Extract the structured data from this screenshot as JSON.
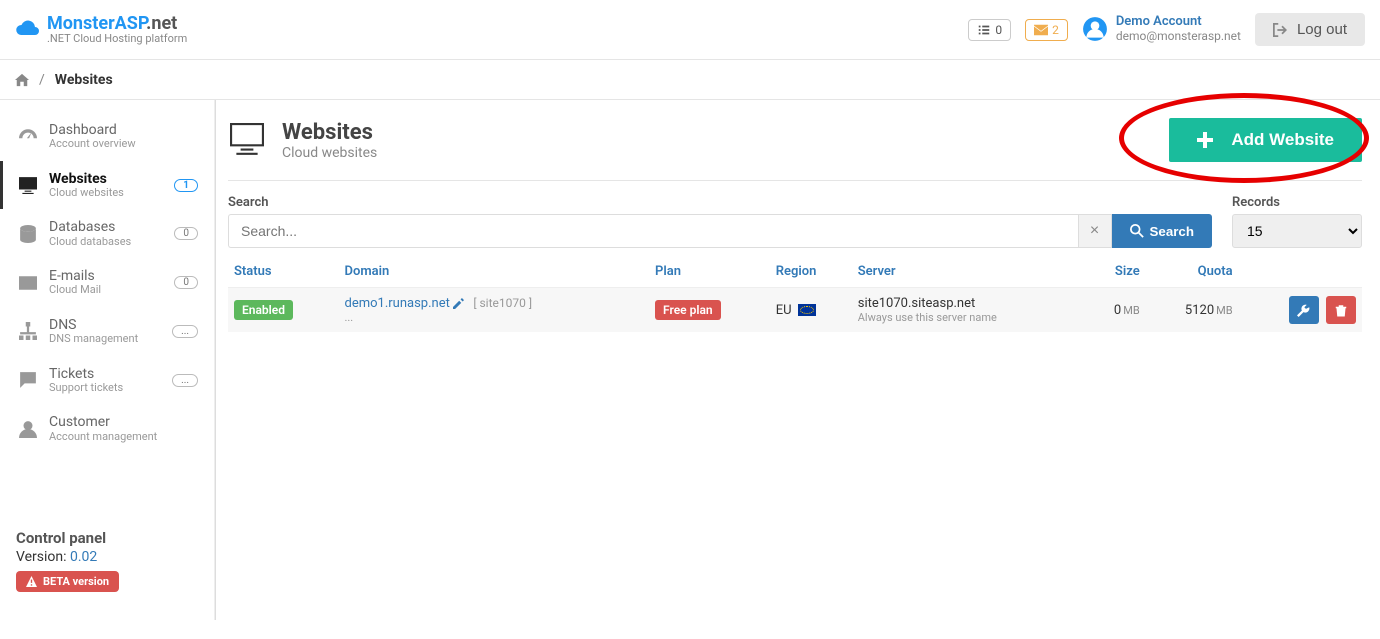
{
  "brand": {
    "name_html_a": "Monster",
    "name_html_b": "ASP",
    "name_html_c": ".net",
    "tagline": ".NET Cloud Hosting platform"
  },
  "top": {
    "tasks_count": "0",
    "mail_count": "2",
    "account_name": "Demo Account",
    "account_email": "demo@monsterasp.net",
    "logout": "Log out"
  },
  "breadcrumb": {
    "current": "Websites"
  },
  "sidebar": {
    "items": [
      {
        "title": "Dashboard",
        "sub": "Account overview",
        "badge": null
      },
      {
        "title": "Websites",
        "sub": "Cloud websites",
        "badge": "1",
        "active": true,
        "blue": true
      },
      {
        "title": "Databases",
        "sub": "Cloud databases",
        "badge": "0"
      },
      {
        "title": "E-mails",
        "sub": "Cloud Mail",
        "badge": "0"
      },
      {
        "title": "DNS",
        "sub": "DNS management",
        "badge": "..."
      },
      {
        "title": "Tickets",
        "sub": "Support tickets",
        "badge": "..."
      },
      {
        "title": "Customer",
        "sub": "Account management",
        "badge": null
      }
    ],
    "footer": {
      "title": "Control panel",
      "version_label": "Version: ",
      "version": "0.02",
      "beta": "BETA version"
    }
  },
  "page": {
    "title": "Websites",
    "subtitle": "Cloud websites",
    "add_button": "Add Website"
  },
  "filters": {
    "search_label": "Search",
    "search_placeholder": "Search...",
    "search_button": "Search",
    "records_label": "Records",
    "records_value": "15"
  },
  "table": {
    "headers": {
      "status": "Status",
      "domain": "Domain",
      "plan": "Plan",
      "region": "Region",
      "server": "Server",
      "size": "Size",
      "quota": "Quota"
    },
    "rows": [
      {
        "status": "Enabled",
        "domain": "demo1.runasp.net",
        "domain_meta": "[ site1070 ]",
        "plan": "Free plan",
        "region": "EU",
        "server": "site1070.siteasp.net",
        "server_sub": "Always use this server name",
        "size_val": "0",
        "size_unit": "MB",
        "quota_val": "5120",
        "quota_unit": "MB"
      }
    ]
  }
}
